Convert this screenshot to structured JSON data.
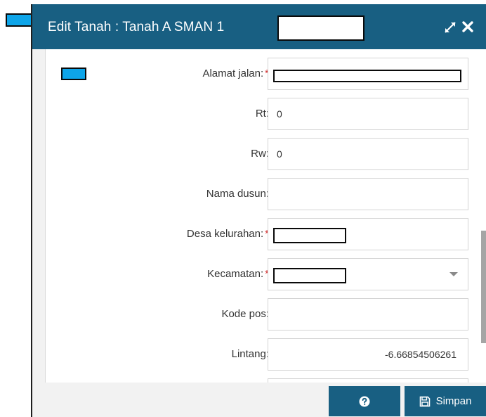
{
  "dialog": {
    "title": "Edit Tanah : Tanah A SMAN 1",
    "expand_icon": "expand-arrows-icon",
    "close_icon": "close-x-icon"
  },
  "form": {
    "fields": [
      {
        "label": "Alamat jalan:",
        "required": true,
        "value": ""
      },
      {
        "label": "Rt:",
        "required": false,
        "value": "0"
      },
      {
        "label": "Rw:",
        "required": false,
        "value": "0"
      },
      {
        "label": "Nama dusun:",
        "required": false,
        "value": ""
      },
      {
        "label": "Desa kelurahan:",
        "required": true,
        "value": ""
      },
      {
        "label": "Kecamatan:",
        "required": true,
        "value": ""
      },
      {
        "label": "Kode pos:",
        "required": false,
        "value": ""
      },
      {
        "label": "Lintang:",
        "required": false,
        "value": "-6.66854506261"
      }
    ],
    "required_marker": "*"
  },
  "footer": {
    "help_icon": "question-circle-icon",
    "save_icon": "floppy-disk-icon",
    "save_label": "Simpan"
  },
  "colors": {
    "header_bg": "#185f82",
    "button_bg": "#185f82",
    "required": "#d32f2f"
  }
}
